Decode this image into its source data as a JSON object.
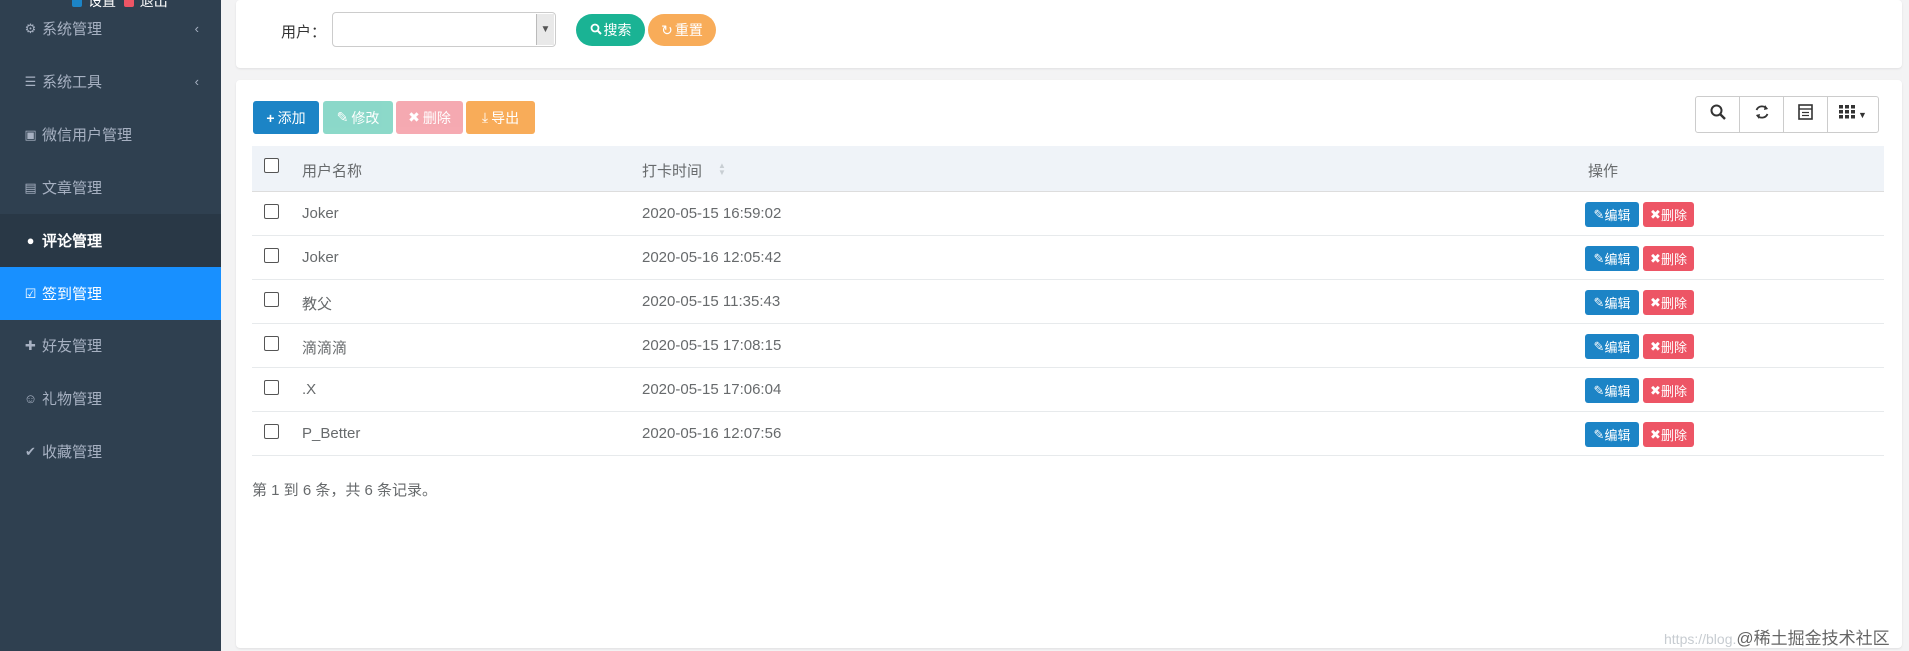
{
  "sidebar": {
    "top_items": [
      "设置",
      "退出"
    ],
    "items": [
      {
        "icon": "gear-icon",
        "glyph": "⚙",
        "label": "系统管理",
        "chevron": "‹"
      },
      {
        "icon": "bars-icon",
        "glyph": "☰",
        "label": "系统工具",
        "chevron": "‹"
      },
      {
        "icon": "address-book-icon",
        "glyph": "▣",
        "label": "微信用户管理"
      },
      {
        "icon": "book-icon",
        "glyph": "▤",
        "label": "文章管理"
      },
      {
        "icon": "comment-icon",
        "glyph": "●",
        "label": "评论管理"
      },
      {
        "icon": "check-square-icon",
        "glyph": "☑",
        "label": "签到管理"
      },
      {
        "icon": "user-plus-icon",
        "glyph": "✚",
        "label": "好友管理"
      },
      {
        "icon": "smile-icon",
        "glyph": "☺",
        "label": "礼物管理"
      },
      {
        "icon": "thumbs-up-icon",
        "glyph": "✔",
        "label": "收藏管理"
      }
    ]
  },
  "search": {
    "user_label": "用户：",
    "user_value": "",
    "search_label": "搜索",
    "reset_label": "重置"
  },
  "toolbar": {
    "add_label": "添加",
    "edit_label": "修改",
    "delete_label": "删除",
    "export_label": "导出"
  },
  "table": {
    "headers": {
      "name": "用户名称",
      "time": "打卡时间",
      "actions": "操作"
    },
    "edit_label": "编辑",
    "delete_label": "删除",
    "rows": [
      {
        "name": "Joker",
        "time": "2020-05-15 16:59:02"
      },
      {
        "name": "Joker",
        "time": "2020-05-16 12:05:42"
      },
      {
        "name": "教父",
        "time": "2020-05-15 11:35:43"
      },
      {
        "name": "滴滴滴",
        "time": "2020-05-15 17:08:15"
      },
      {
        "name": ".X",
        "time": "2020-05-15 17:06:04"
      },
      {
        "name": "P_Better",
        "time": "2020-05-16 12:07:56"
      }
    ]
  },
  "pager": {
    "summary": "第 1 到 6 条，共 6 条记录。"
  },
  "watermark": {
    "url": "https://blog.",
    "brand": "@稀土掘金技术社区"
  },
  "colors": {
    "sidebar_bg": "#2f4050",
    "active": "#1890ff",
    "primary": "#1c84c6",
    "success": "#1ab394",
    "warning": "#f8ac59",
    "danger": "#ed5565"
  }
}
